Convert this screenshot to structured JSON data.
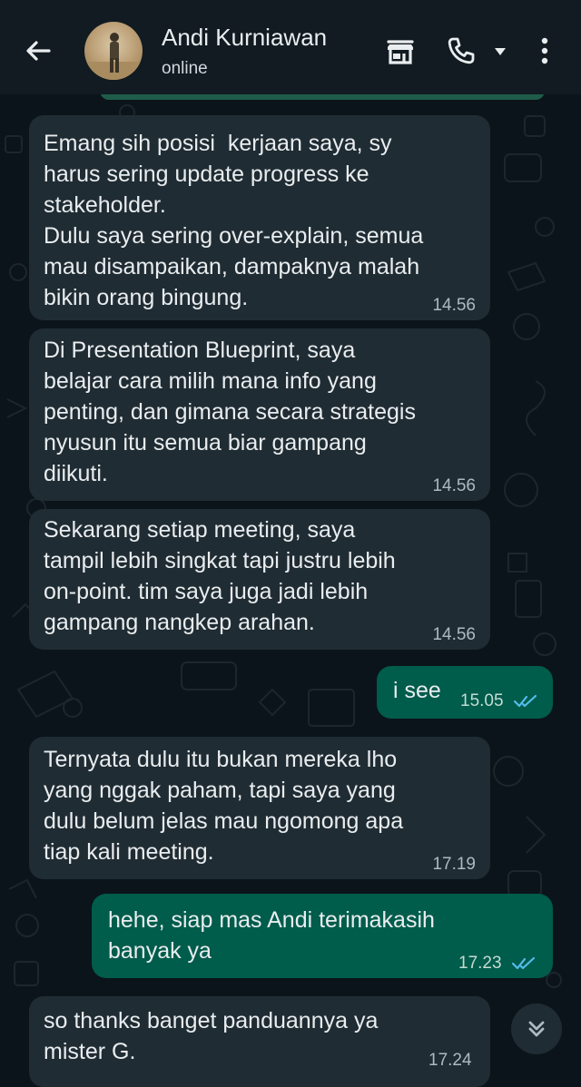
{
  "header": {
    "contact_name": "Andi Kurniawan",
    "status": "online"
  },
  "icons": {
    "back": "arrow-left-icon",
    "shop": "storefront-icon",
    "call": "phone-icon",
    "more": "more-vertical-icon",
    "scroll_down": "double-chevron-down-icon"
  },
  "colors": {
    "header_bg": "#111b21",
    "chat_bg": "#0b141a",
    "incoming_bubble": "#202c33",
    "outgoing_bubble": "#005c4b",
    "read_receipt": "#53bdeb"
  },
  "messages": [
    {
      "direction": "incoming",
      "lines": [
        "Emang sih posisi  kerjaan saya, sy",
        "harus sering update progress ke",
        "stakeholder.",
        "Dulu saya sering over-explain, semua",
        "mau disampaikan, dampaknya malah",
        "bikin orang bingung."
      ],
      "text": "Emang sih posisi  kerjaan saya, sy\nharus sering update progress ke\nstakeholder.\nDulu saya sering over-explain, semua\nmau disampaikan, dampaknya malah\nbikin orang bingung.",
      "time": "14.56"
    },
    {
      "direction": "incoming",
      "text": "Di Presentation Blueprint, saya\nbelajar cara milih mana info yang\npenting, dan gimana secara strategis\nnyusun itu semua biar gampang\ndiikuti.",
      "time": "14.56"
    },
    {
      "direction": "incoming",
      "text": "Sekarang setiap meeting, saya\ntampil lebih singkat tapi justru lebih\non-point. tim saya juga jadi lebih\ngampang nangkep arahan.",
      "time": "14.56"
    },
    {
      "direction": "outgoing",
      "text": "i see",
      "time": "15.05",
      "read": true
    },
    {
      "direction": "incoming",
      "text": "Ternyata dulu itu bukan mereka lho\nyang nggak paham, tapi saya yang\ndulu belum jelas mau ngomong apa\ntiap kali meeting.",
      "time": "17.19"
    },
    {
      "direction": "outgoing",
      "text": "hehe, siap mas Andi terimakasih\nbanyak ya",
      "time": "17.23",
      "read": true
    },
    {
      "direction": "incoming",
      "text": "so thanks banget panduannya ya\nmister G.",
      "time": "17.24"
    }
  ]
}
